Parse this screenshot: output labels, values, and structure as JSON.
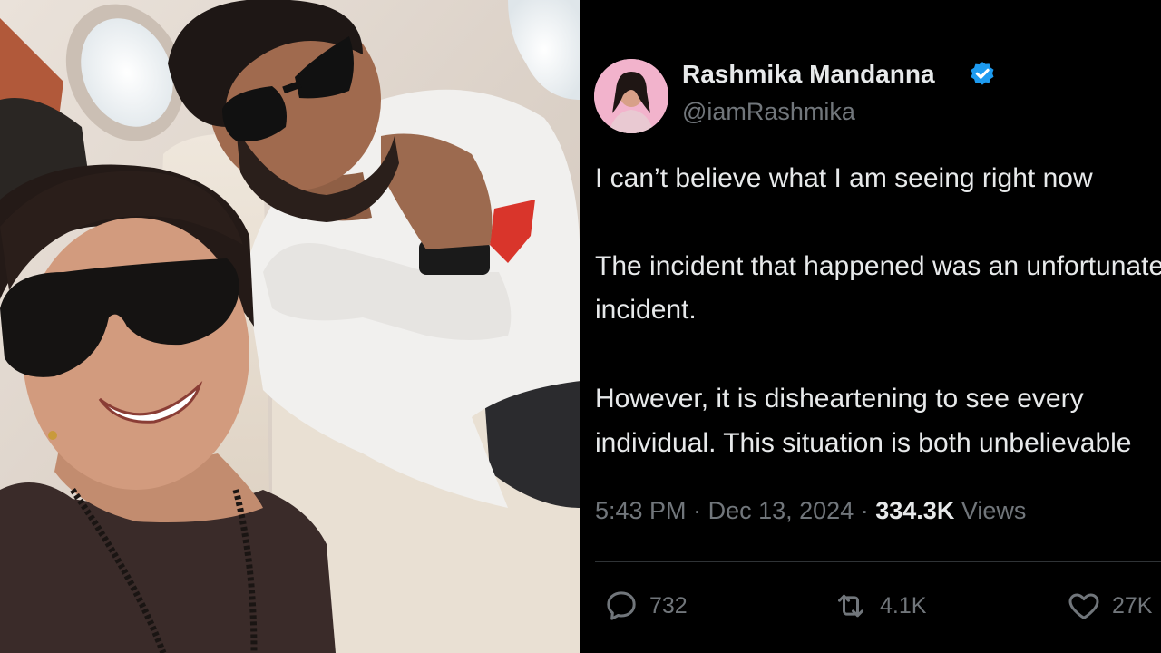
{
  "tweet": {
    "display_name": "Rashmika Mandanna",
    "handle": "@iamRashmika",
    "lines": [
      "I can’t believe what I am seeing right now",
      "The incident that happened was an unfortunate",
      "incident.",
      "However, it is disheartening to see every",
      "individual. This situation is both unbelievable"
    ],
    "time": "5:43 PM",
    "separator": "·",
    "date": "Dec 13, 2024",
    "views_count": "334.3K",
    "views_label": "Views",
    "replies": "732",
    "reposts": "4.1K",
    "likes": "27K",
    "icons": {
      "verified": "verified-badge-icon",
      "reply": "reply-icon",
      "repost": "repost-icon",
      "like": "heart-icon"
    },
    "colors": {
      "background": "#000000",
      "text": "#e7e9ea",
      "muted": "#71767b",
      "verified": "#1d9bf0"
    }
  }
}
